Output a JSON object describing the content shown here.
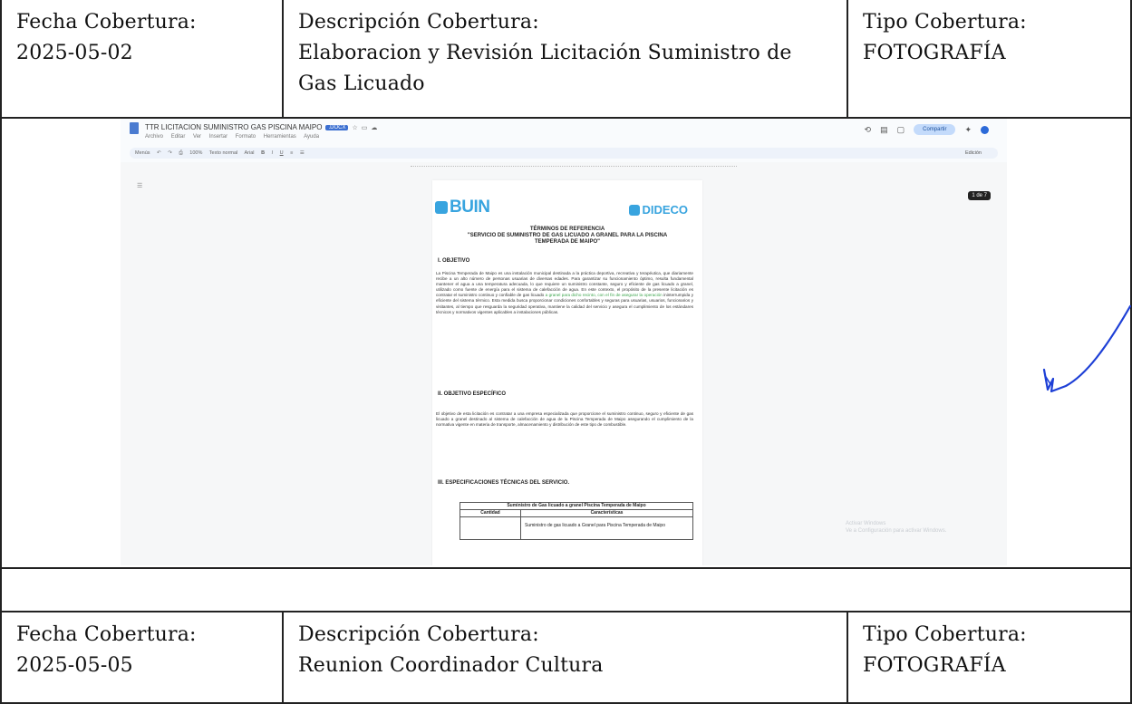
{
  "cover1": {
    "date_label": "Fecha Cobertura:",
    "date": "2025-05-02",
    "desc_label": "Descripción Cobertura:",
    "desc": "Elaboracion y Revisión Licitación Suministro de Gas Licuado",
    "type_label": "Tipo Cobertura:",
    "type": "FOTOGRAFÍA"
  },
  "cover2": {
    "date_label": "Fecha Cobertura:",
    "date": "2025-05-05",
    "desc_label": "Descripción Cobertura:",
    "desc": "Reunion Coordinador Cultura",
    "type_label": "Tipo Cobertura:",
    "type": "FOTOGRAFÍA"
  },
  "screenshot": {
    "doc_title": "TTR LICITACION SUMINISTRO GAS PISCINA MAIPO",
    "doc_badge": ".DOCX",
    "menu": [
      "Archivo",
      "Editar",
      "Ver",
      "Insertar",
      "Formato",
      "Herramientas",
      "Ayuda"
    ],
    "share_label": "Compartir",
    "toolbar_zoom": "100%",
    "toolbar_style": "Texto normal",
    "toolbar_font": "Arial",
    "toolbar_menus": "Menús",
    "edit_mode": "Edición",
    "page_counter": "1 de 7",
    "logo_left": "BUIN",
    "logo_right": "DIDECO",
    "heading_line1": "TÉRMINOS DE REFERENCIA",
    "heading_line2": "\"SERVICIO DE SUMINISTRO DE GAS LICUADO A GRANEL PARA LA PISCINA",
    "heading_line3": "TEMPERADA DE MAIPO\"",
    "sec1_title": "I.   OBJETIVO",
    "sec1_text_a": "La Piscina Temperada de Maipo es una instalación municipal destinada a la práctica deportiva, recreativa y terapéutica, que diariamente recibe a un alto número de personas usuarias de diversas edades. Para garantizar su funcionamiento óptimo, resulta fundamental mantener el agua a una temperatura adecuada, lo que requiere un suministro constante, seguro y eficiente de gas licuado a granel, utilizado como fuente de energía para el sistema de calefacción de agua. En este contexto, el propósito de la presente licitación es contratar el suministro continuo y confiable de gas licuado",
    "sec1_text_hl": "a granel para dicho recinto, con el fin de asegurar la operación",
    "sec1_text_b": "ininterrumpida y eficiente del sistema térmico. Esta medida busca proporcionar condiciones confortables y seguras para usuarias, usuarios, funcionarios y visitantes, al tiempo que resguarda la seguridad operativa, mantiene la calidad del servicio y asegura el cumplimiento de los estándares técnicos y normativos vigentes aplicables a instalaciones públicas.",
    "sec2_title": "II.   OBJETIVO ESPECÍFICO",
    "sec2_text": "El objetivo de esta licitación es contratar a una empresa especializada que proporcione el suministro continuo, seguro y eficiente de gas licuado a granel destinado al sistema de calefacción de agua de la Piscina Temperada de Maipo asegurando el cumplimiento de la normativa vigente en materia de transporte, almacenamiento y distribución de este tipo de combustible.",
    "sec3_title": "III.   ESPECIFICACIONES TÉCNICAS DEL SERVICIO.",
    "table_title": "Suministro de Gas licuado a granel Piscina Temperada de Maipo",
    "table_col1": "Cantidad",
    "table_col2": "Características",
    "table_cell": "Suministro de gas licuado a Granel para Piscina Temperada de Maipo",
    "watermark_line1": "Activar Windows",
    "watermark_line2": "Ve a Configuración para activar Windows."
  },
  "colors": {
    "border": "#222222",
    "logo": "#38a4df",
    "share": "#c4dbfb",
    "signature": "#1d3fd6",
    "highlight": "#3aa44a"
  }
}
